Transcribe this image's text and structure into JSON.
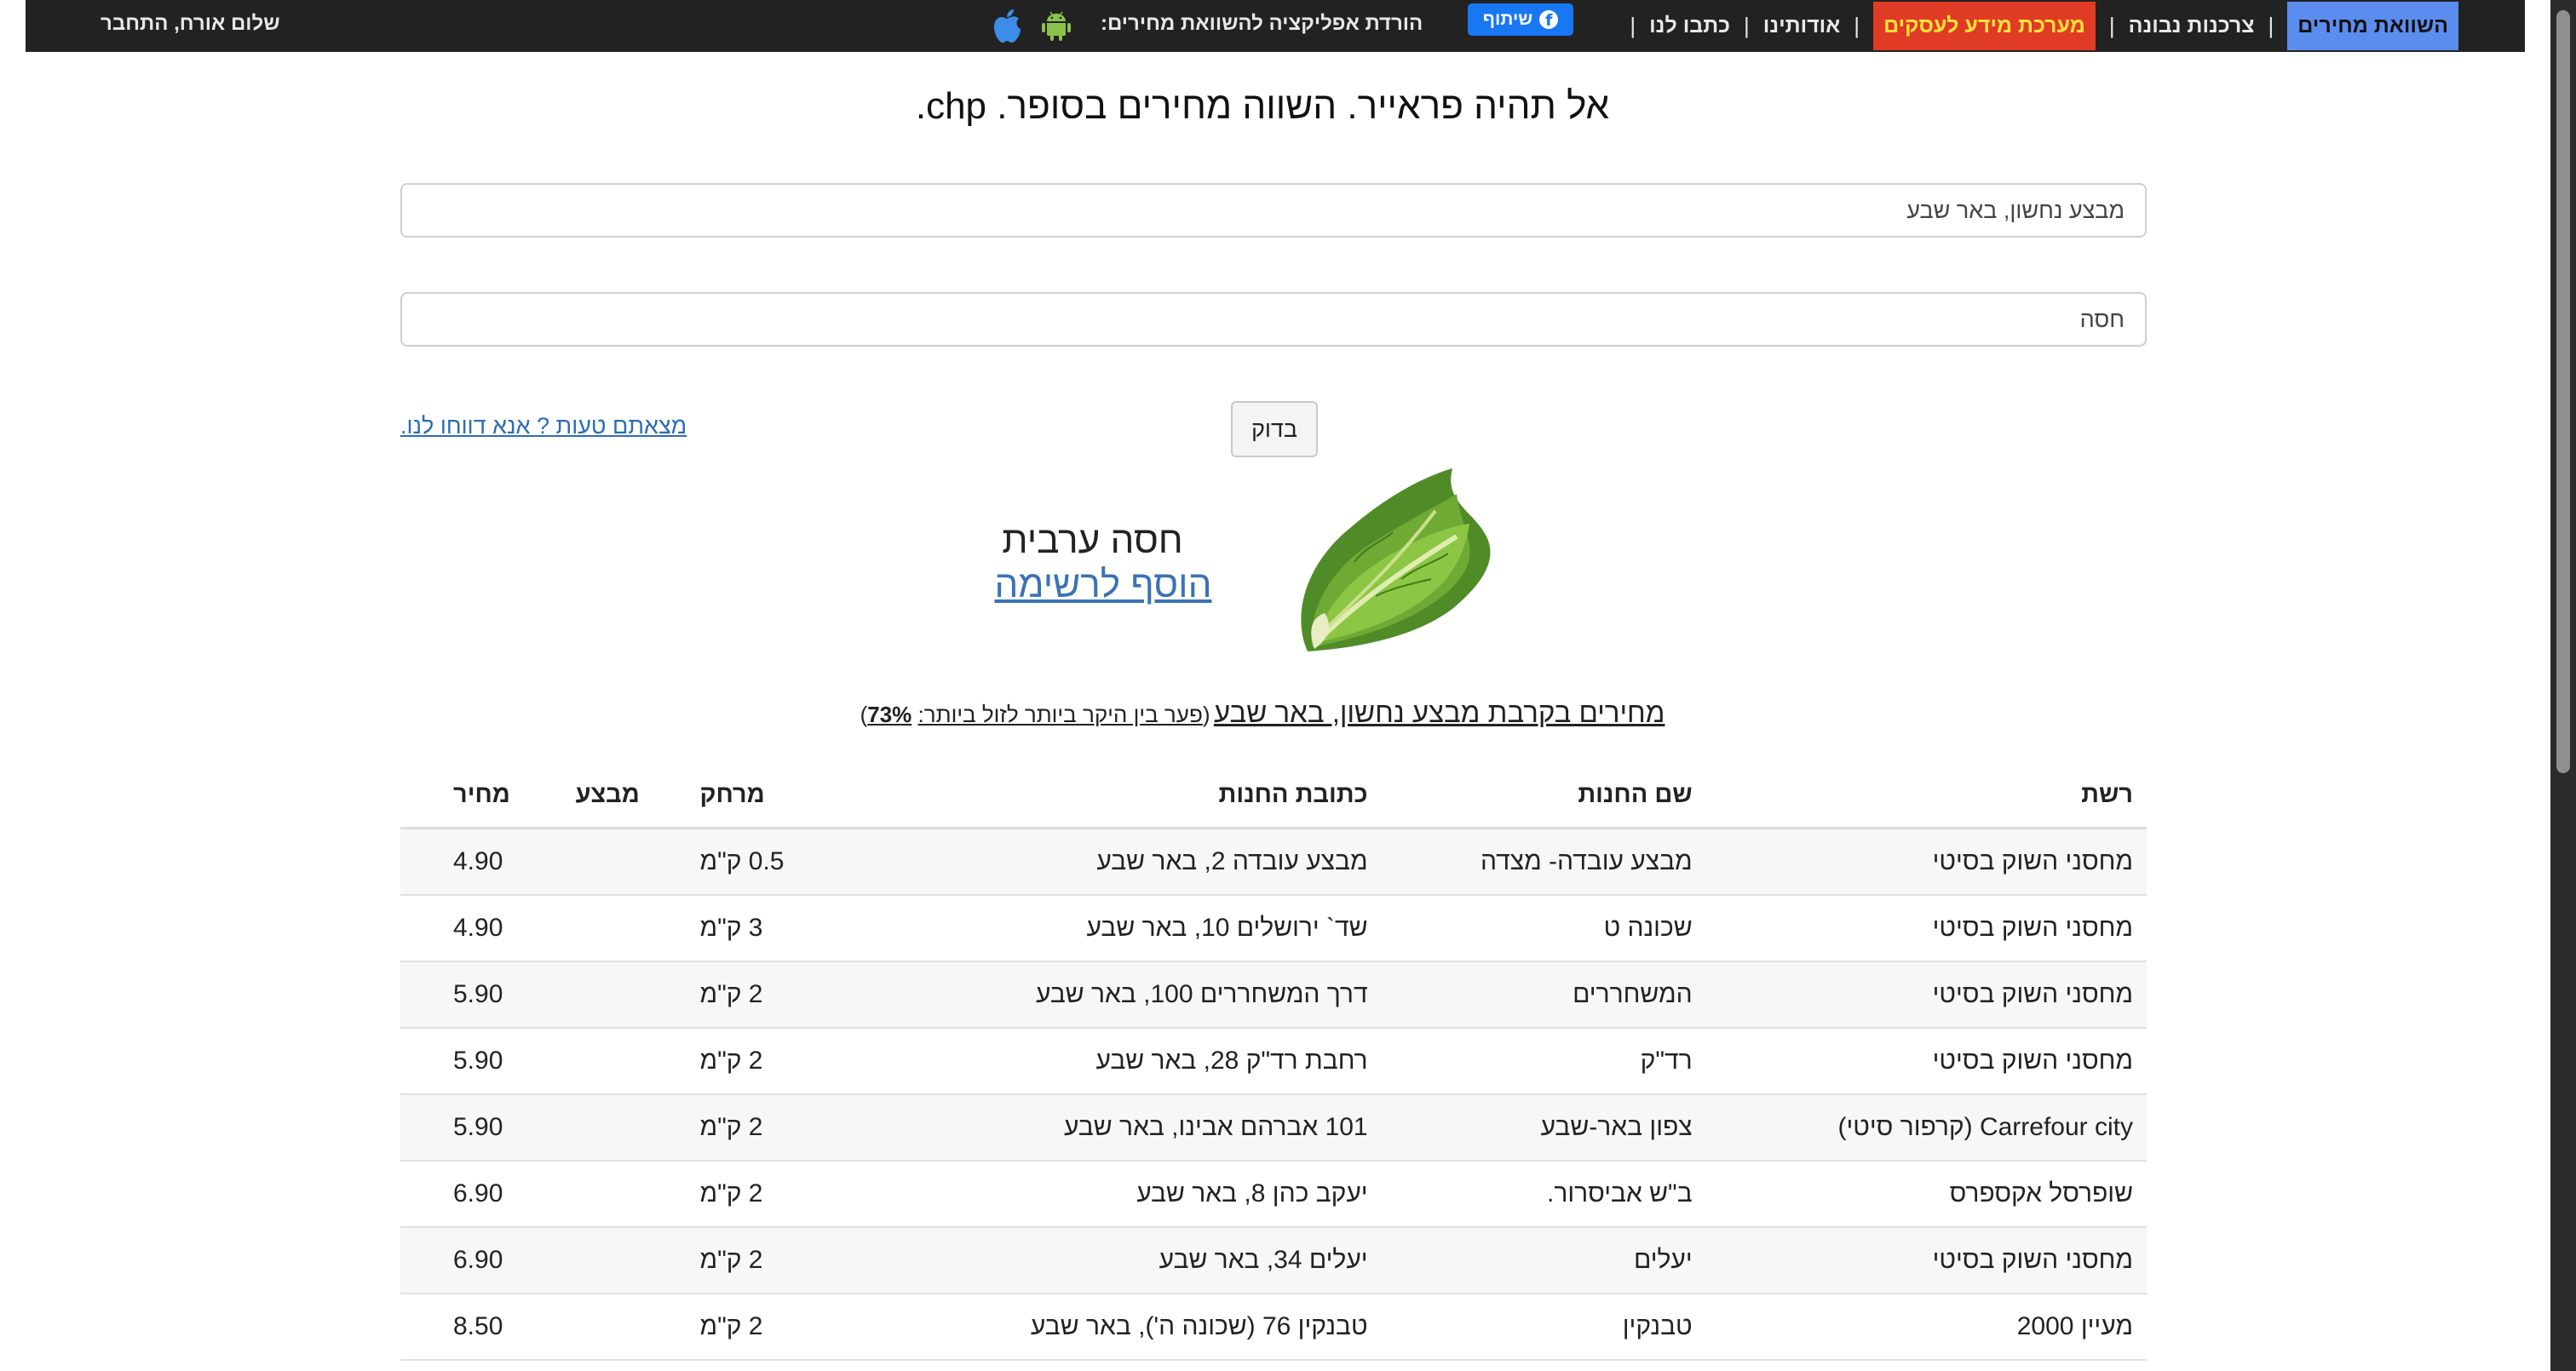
{
  "nav": {
    "items": [
      {
        "label": "השוואת מחירים",
        "style": "active"
      },
      {
        "label": "צרכנות נבונה",
        "style": "normal"
      },
      {
        "label": "מערכת מידע לעסקים",
        "style": "business"
      },
      {
        "label": "אודותינו",
        "style": "normal"
      },
      {
        "label": "כתבו לנו",
        "style": "normal"
      }
    ],
    "share_button": "שיתוף",
    "app_download_label": "הורדת אפליקציה להשוואת מחירים:",
    "greeting": "שלום אורח, התחבר"
  },
  "heading": "אל תהיה פראייר. השווה מחירים בסופר. chp.",
  "search": {
    "location_value": "מבצע נחשון, באר שבע",
    "product_value": "חסה",
    "check_button": "בדוק",
    "report_link": "מצאתם טעות ? אנא דווחו לנו."
  },
  "product": {
    "name": "חסה ערבית",
    "add_to_list": "הוסף לרשימה",
    "image": "lettuce"
  },
  "prices_title": {
    "main": "מחירים בקרבת מבצע נחשון, באר שבע",
    "gap_label": "פער בין היקר ביותר לזול ביותר:",
    "gap_value": "73%"
  },
  "table": {
    "headers": {
      "chain": "רשת",
      "store": "שם החנות",
      "address": "כתובת החנות",
      "distance": "מרחק",
      "deal": "מבצע",
      "price": "מחיר"
    },
    "rows": [
      {
        "chain": "מחסני השוק בסיטי",
        "store": "מבצע עובדה- מצדה",
        "address": "מבצע עובדה 2, באר שבע",
        "distance": "0.5 ק\"מ",
        "deal": "",
        "price": "4.90"
      },
      {
        "chain": "מחסני השוק בסיטי",
        "store": "שכונה ט",
        "address": "שד` ירושלים 10, באר שבע",
        "distance": "3 ק\"מ",
        "deal": "",
        "price": "4.90"
      },
      {
        "chain": "מחסני השוק בסיטי",
        "store": "המשחררים",
        "address": "דרך המשחררים 100, באר שבע",
        "distance": "2 ק\"מ",
        "deal": "",
        "price": "5.90"
      },
      {
        "chain": "מחסני השוק בסיטי",
        "store": "רד\"ק",
        "address": "רחבת רד\"ק 28, באר שבע",
        "distance": "2 ק\"מ",
        "deal": "",
        "price": "5.90"
      },
      {
        "chain": "Carrefour city (קרפור סיטי)",
        "store": "צפון באר-שבע",
        "address": "101 אברהם אבינו, באר שבע",
        "distance": "2 ק\"מ",
        "deal": "",
        "price": "5.90"
      },
      {
        "chain": "שופרסל אקספרס",
        "store": "ב\"ש אביסרור.",
        "address": "יעקב כהן 8, באר שבע",
        "distance": "2 ק\"מ",
        "deal": "",
        "price": "6.90"
      },
      {
        "chain": "מחסני השוק בסיטי",
        "store": "יעלים",
        "address": "יעלים 34, באר שבע",
        "distance": "2 ק\"מ",
        "deal": "",
        "price": "6.90"
      },
      {
        "chain": "מעיין 2000",
        "store": "טבנקין",
        "address": "טבנקין 76 (שכונה ה'), באר שבע",
        "distance": "2 ק\"מ",
        "deal": "",
        "price": "8.50"
      }
    ]
  },
  "colors": {
    "topbar": "#222222",
    "active_tab": "#5b8def",
    "business_tab_bg": "#e03b24",
    "business_tab_text": "#ffe23b",
    "link": "#3a72b6",
    "facebook": "#1877f2"
  }
}
